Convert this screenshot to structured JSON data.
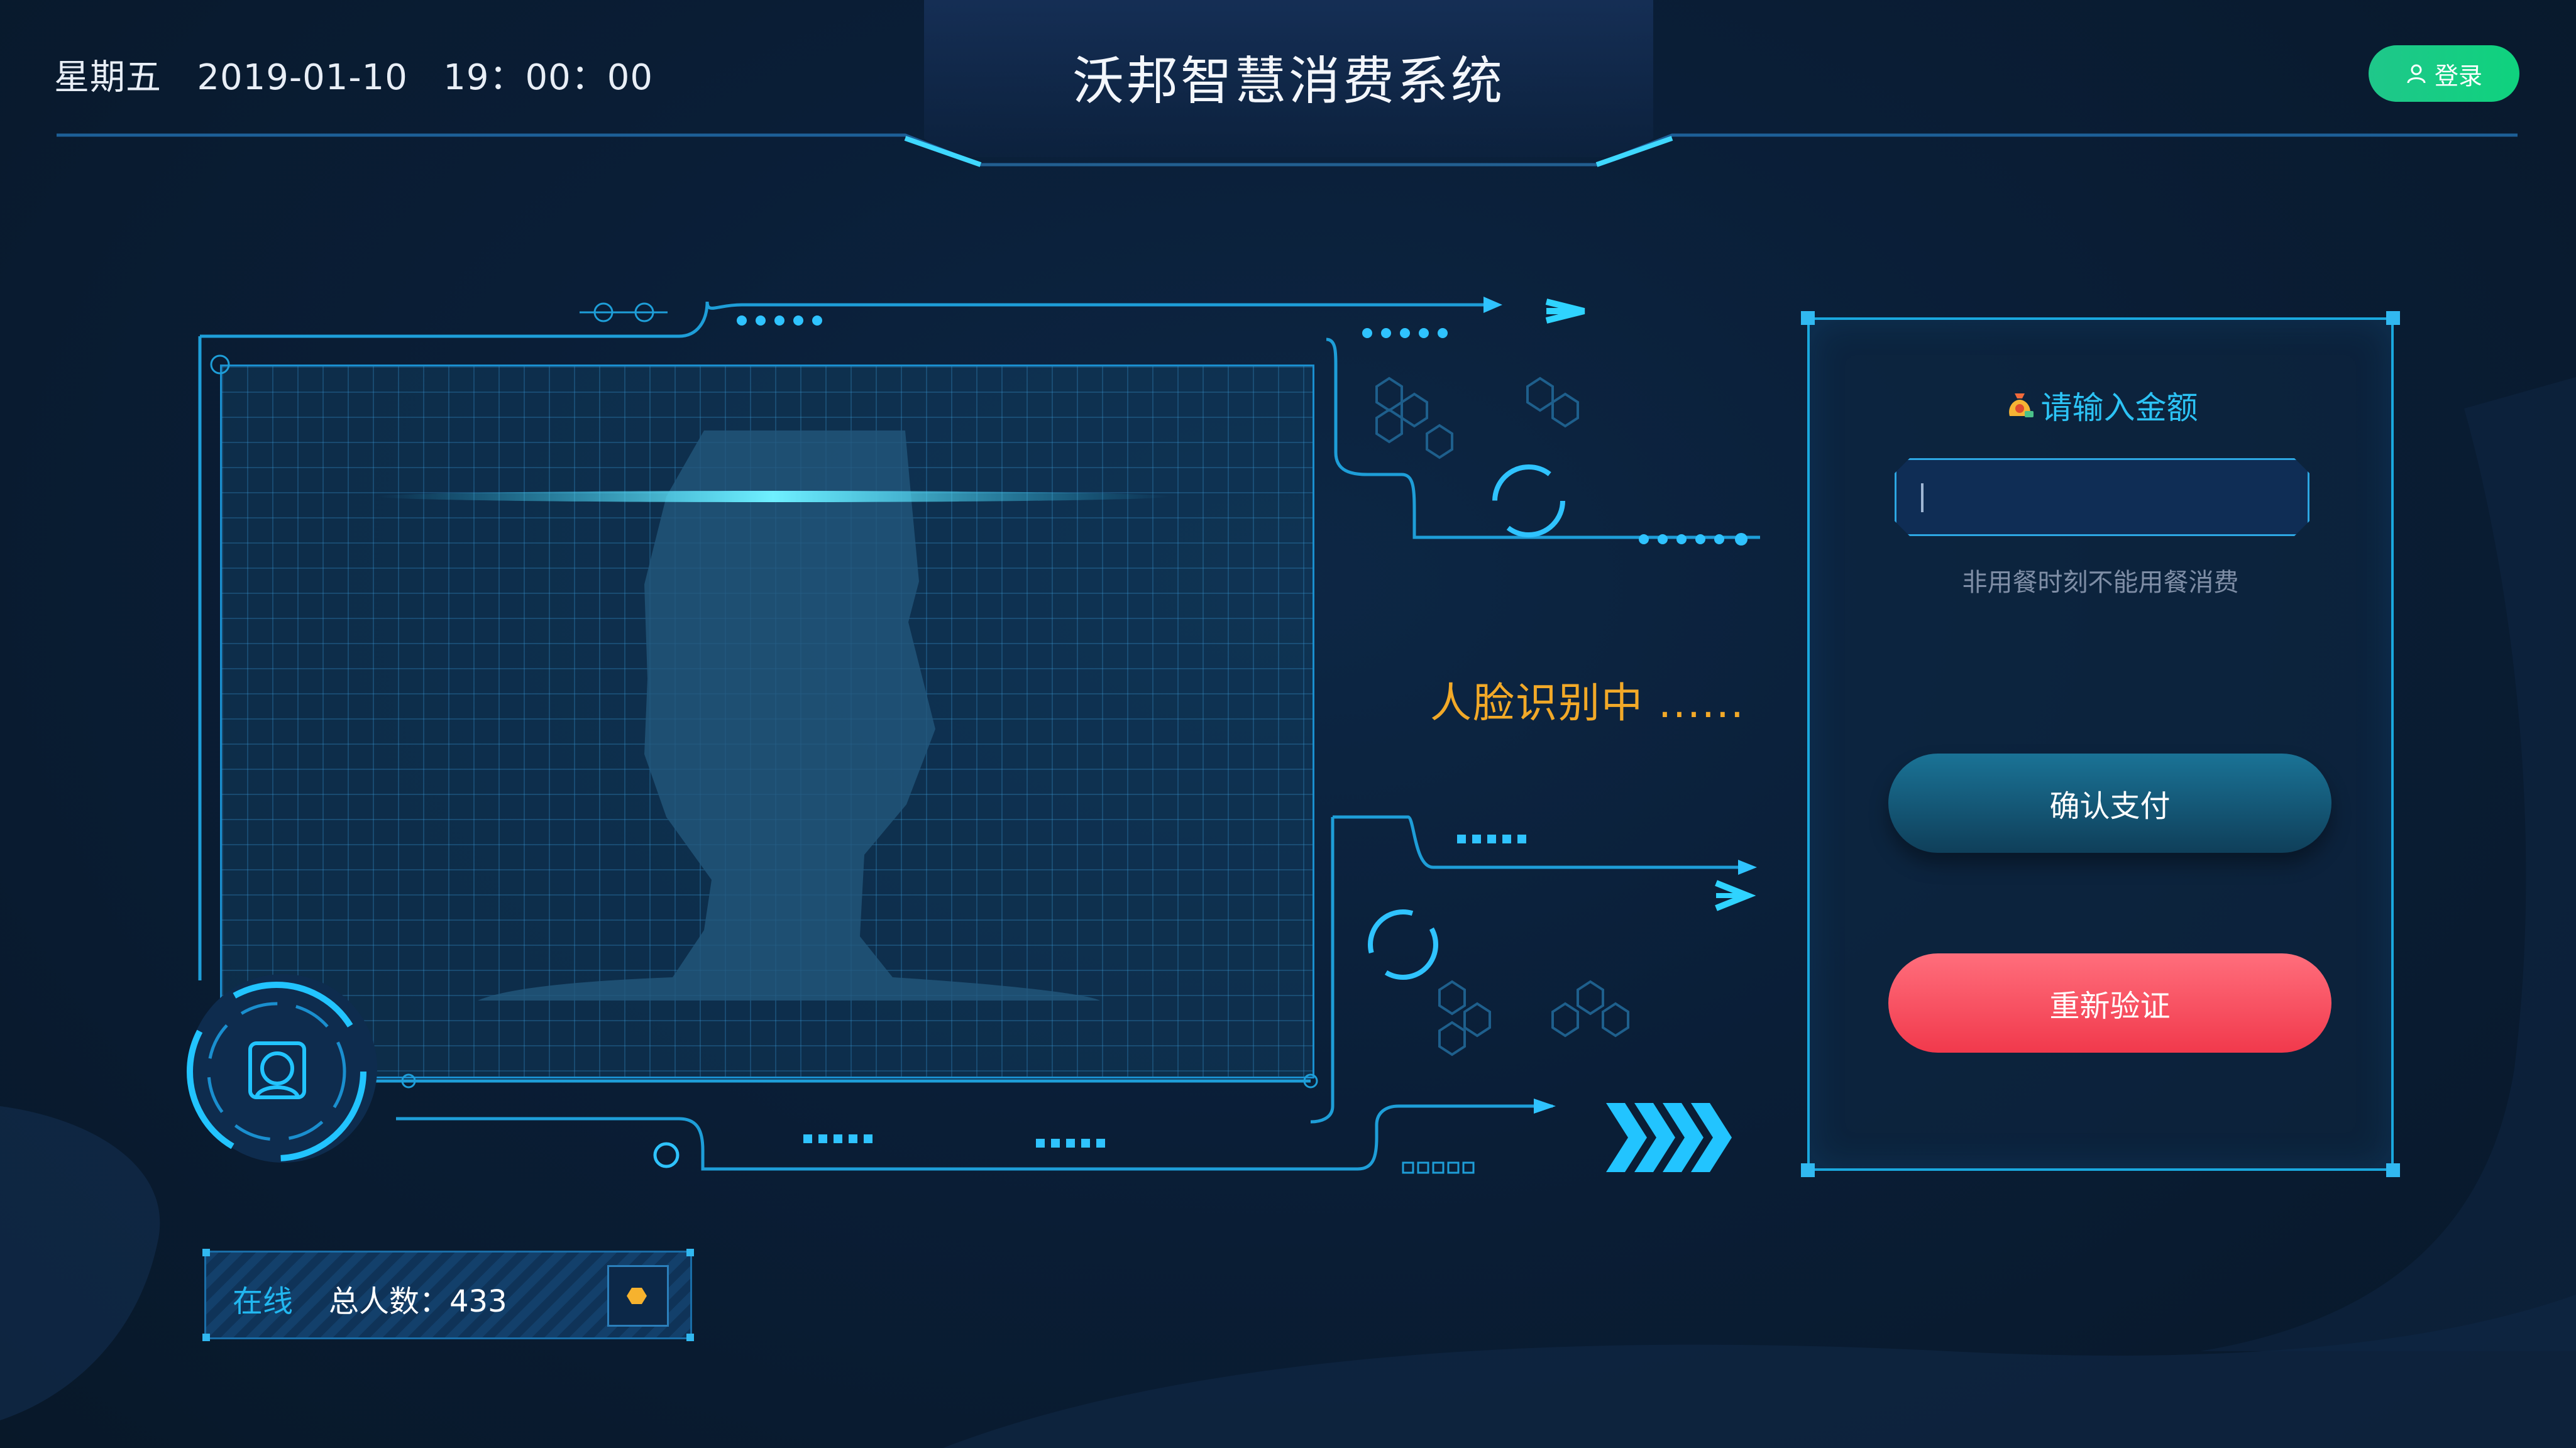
{
  "header": {
    "datetime": "星期五   2019-01-10   19：00：00",
    "title": "沃邦智慧消费系统",
    "login_label": "登录"
  },
  "recognition": {
    "status_text": "人脸识别中 ......"
  },
  "amount_panel": {
    "title": "请输入金额",
    "input_value": "",
    "hint": "非用餐时刻不能用餐消费",
    "confirm_label": "确认支付",
    "reverify_label": "重新验证"
  },
  "status_bar": {
    "online_label": "在线",
    "total_label": "总人数：433"
  },
  "colors": {
    "accent": "#1aa8de",
    "login": "#12d07f",
    "recog": "#f2a928",
    "reverify": "#f1394c",
    "confirm": "#1a7396"
  },
  "icons": {
    "login": "user-icon",
    "amount": "money-bag-icon",
    "face": "face-scan-icon",
    "online": "hexagon-icon"
  }
}
